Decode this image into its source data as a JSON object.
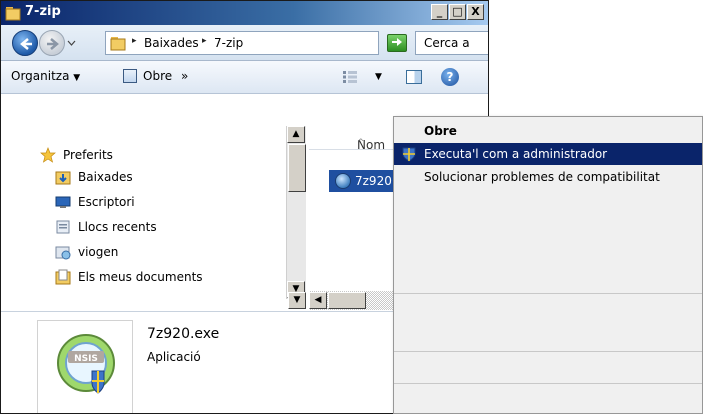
{
  "window": {
    "title": "7-zip",
    "minimize": "_",
    "maximize": "□",
    "close": "X"
  },
  "address": {
    "crumbs": [
      "Baixades",
      "7-zip"
    ],
    "search_placeholder": "Cerca a"
  },
  "toolbar": {
    "organize_label": "Organitza",
    "open_label": "Obre",
    "more_label": "»"
  },
  "nav": {
    "favorites_label": "Preferits",
    "items": [
      "Baixades",
      "Escriptori",
      "Llocs recents",
      "viogen",
      "Els meus documents"
    ]
  },
  "filelist": {
    "col_name": "Nom",
    "files": [
      "7z920.exe"
    ]
  },
  "details": {
    "filename": "7z920.exe",
    "filetype": "Aplicació",
    "icon_text": "NSIS"
  },
  "context_menu": {
    "items": [
      "Obre",
      "Executa'l com a administrador",
      "Solucionar problemes de compatibilitat"
    ]
  },
  "colors": {
    "titlebar": "#0a246a",
    "highlight": "#0a246a",
    "selection": "#1f4fa0"
  }
}
